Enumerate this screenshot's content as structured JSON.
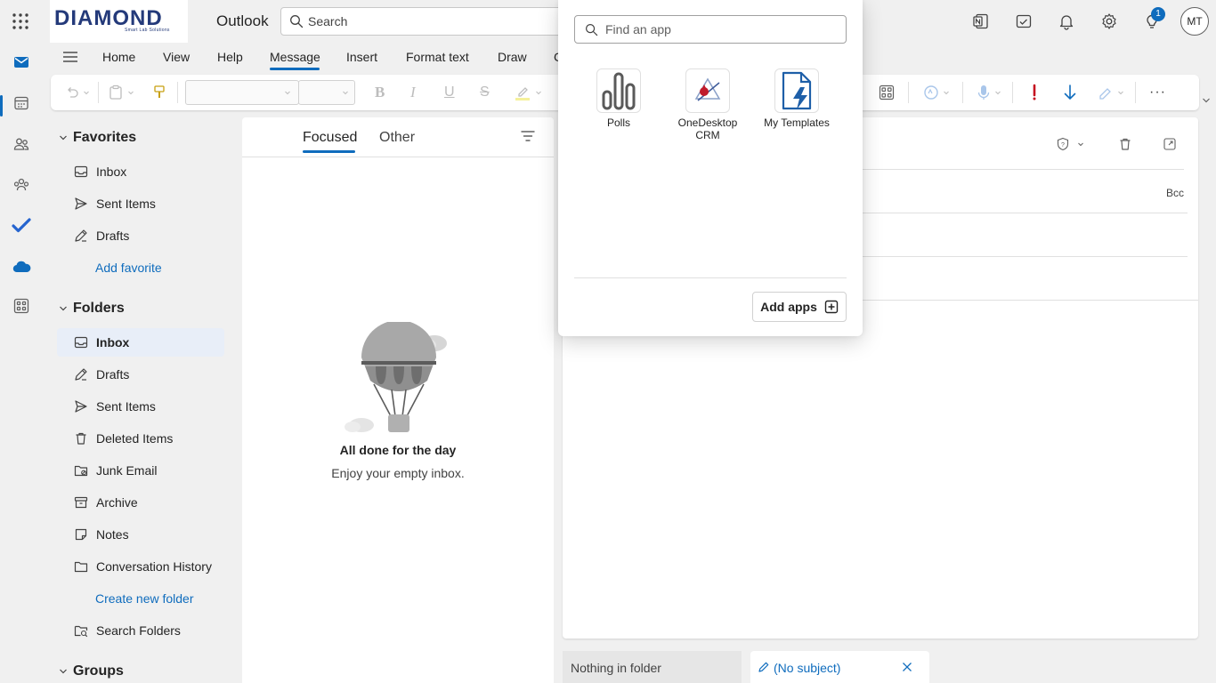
{
  "header": {
    "logo_text": "DIAMOND",
    "logo_tagline": "Smart Lab Solutions",
    "app_name": "Outlook",
    "search_placeholder": "Search",
    "notification_badge": "1",
    "avatar_initials": "MT"
  },
  "ribbon": {
    "tabs": [
      "Home",
      "View",
      "Help",
      "Message",
      "Insert",
      "Format text",
      "Draw",
      "C"
    ],
    "active_tab": "Message"
  },
  "favorites": {
    "heading": "Favorites",
    "items": [
      "Inbox",
      "Sent Items",
      "Drafts"
    ],
    "add_link": "Add favorite"
  },
  "folders": {
    "heading": "Folders",
    "items": [
      "Inbox",
      "Drafts",
      "Sent Items",
      "Deleted Items",
      "Junk Email",
      "Archive",
      "Notes",
      "Conversation History"
    ],
    "create_link": "Create new folder",
    "search_folders": "Search Folders",
    "selected": "Inbox"
  },
  "groups": {
    "heading": "Groups"
  },
  "message_list": {
    "tab_focused": "Focused",
    "tab_other": "Other",
    "empty_title": "All done for the day",
    "empty_subtitle": "Enjoy your empty inbox."
  },
  "compose": {
    "bcc_label": "Bcc"
  },
  "bottom_tabs": {
    "nothing": "Nothing in folder",
    "draft": "(No subject)"
  },
  "app_flyout": {
    "search_placeholder": "Find an app",
    "apps": [
      {
        "label": "Polls",
        "icon": "polls-icon"
      },
      {
        "label": "OneDesktop CRM",
        "icon": "onedesktop-crm-icon"
      },
      {
        "label": "My Templates",
        "icon": "my-templates-icon"
      }
    ],
    "add_apps_label": "Add apps"
  },
  "colors": {
    "accent": "#0f6cbd",
    "background": "#f0f0f0",
    "selected_folder": "#e8eef8"
  }
}
